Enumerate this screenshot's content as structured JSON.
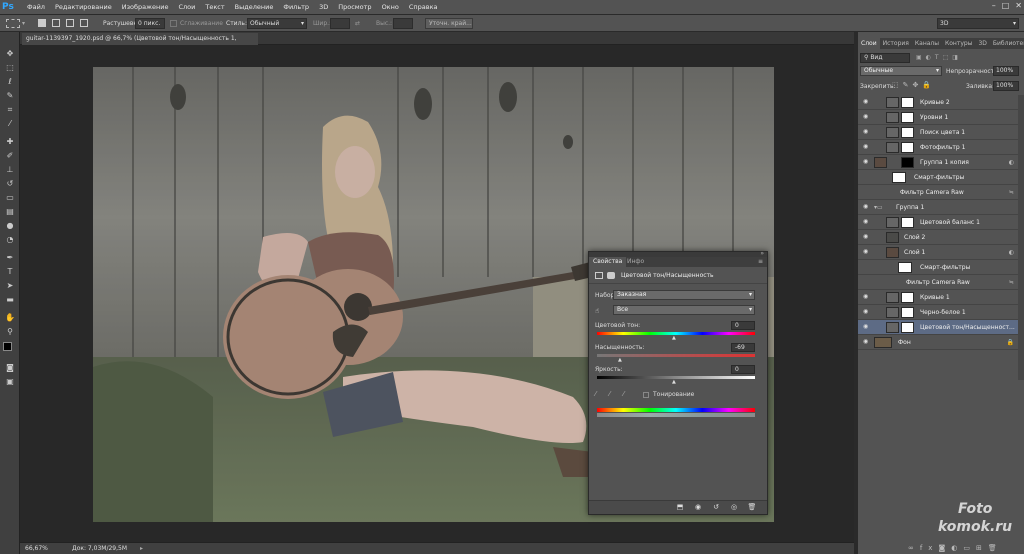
{
  "app": {
    "logo": "Ps"
  },
  "menu": [
    "Файл",
    "Редактирование",
    "Изображение",
    "Слои",
    "Текст",
    "Выделение",
    "Фильтр",
    "3D",
    "Просмотр",
    "Окно",
    "Справка"
  ],
  "options": {
    "feather_label": "Растушевка:",
    "feather_value": "0 пикс.",
    "antialias_label": "Сглаживание",
    "style_label": "Стиль:",
    "style_value": "Обычный",
    "width_label": "Шир.:",
    "height_label": "Выс.:",
    "refine_label": "Уточн. край...",
    "workspace": "3D"
  },
  "document": {
    "tab_title": "guitar-1139397_1920.psd @ 66,7% (Цветовой тон/Насыщенность 1, RGB/8) *"
  },
  "status": {
    "zoom": "66,67%",
    "doc": "Док: 7,03M/29,5M"
  },
  "layers_panel": {
    "tabs": [
      "Слои",
      "История",
      "Каналы",
      "Контуры",
      "3D",
      "Библиотеки"
    ],
    "filter": "Вид",
    "blend_mode": "Обычные",
    "opacity_label": "Непрозрачность:",
    "opacity": "100%",
    "lock_label": "Закрепить:",
    "fill_label": "Заливка:",
    "fill": "100%",
    "layers": [
      "Кривые 2",
      "Уровни 1",
      "Поиск цвета 1",
      "Фотофильтр 1",
      "Группа 1 копия",
      "Смарт-фильтры",
      "Фильтр Camera Raw",
      "Группа 1",
      "Цветовой баланс 1",
      "Слой 2",
      "Слой 1",
      "Смарт-фильтры",
      "Фильтр Camera Raw",
      "Кривые 1",
      "Черно-белое 1",
      "Цветовой тон/Насыщенност...",
      "Фон"
    ]
  },
  "properties": {
    "tabs": [
      "Свойства",
      "Инфо"
    ],
    "title": "Цветовой тон/Насыщенность",
    "preset_label": "Набор:",
    "preset_value": "Заказная",
    "channel_value": "Все",
    "hue_label": "Цветовой тон:",
    "hue_value": "0",
    "sat_label": "Насыщенность:",
    "sat_value": "-69",
    "light_label": "Яркость:",
    "light_value": "0",
    "colorize_label": "Тонирование"
  },
  "watermark": [
    "Foto",
    "komok.ru"
  ]
}
